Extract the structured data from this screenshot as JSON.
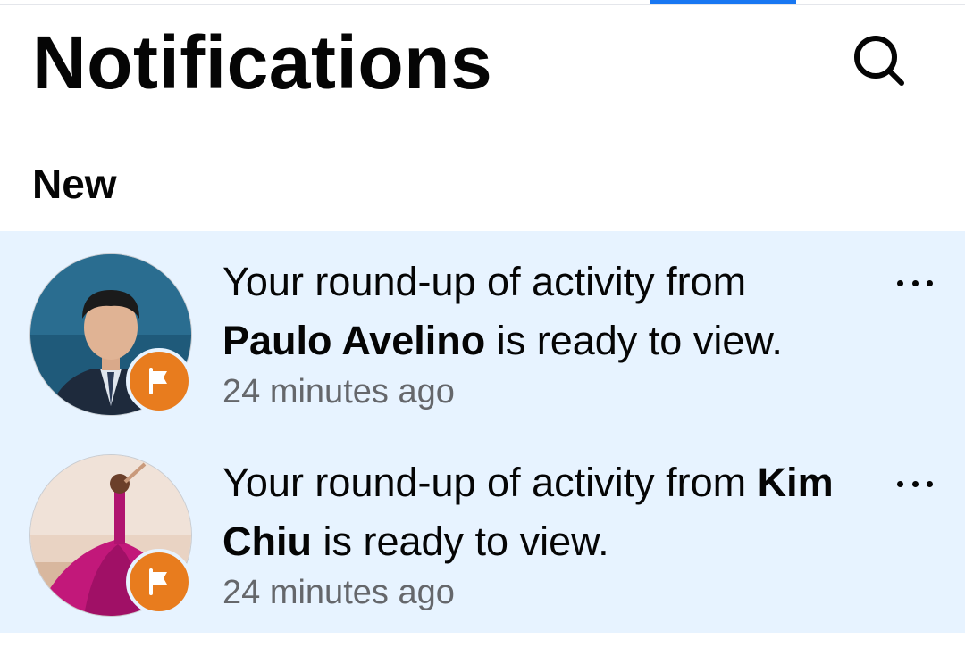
{
  "header": {
    "title": "Notifications",
    "search_icon": "search-icon"
  },
  "section": {
    "heading": "New"
  },
  "notifications": [
    {
      "text_before": "Your round-up of activity from ",
      "name": "Paulo Avelino",
      "text_after": " is ready to view.",
      "time": "24 minutes ago",
      "badge_icon": "flag-icon",
      "more_icon": "more-options-icon"
    },
    {
      "text_before": "Your round-up of activity from ",
      "name": "Kim Chiu",
      "text_after": " is ready to view.",
      "time": "24 minutes ago",
      "badge_icon": "flag-icon",
      "more_icon": "more-options-icon"
    }
  ],
  "colors": {
    "unread_background": "#e7f3ff",
    "badge": "#e87c1e",
    "tab_indicator": "#1877f2",
    "secondary_text": "#65676b"
  }
}
